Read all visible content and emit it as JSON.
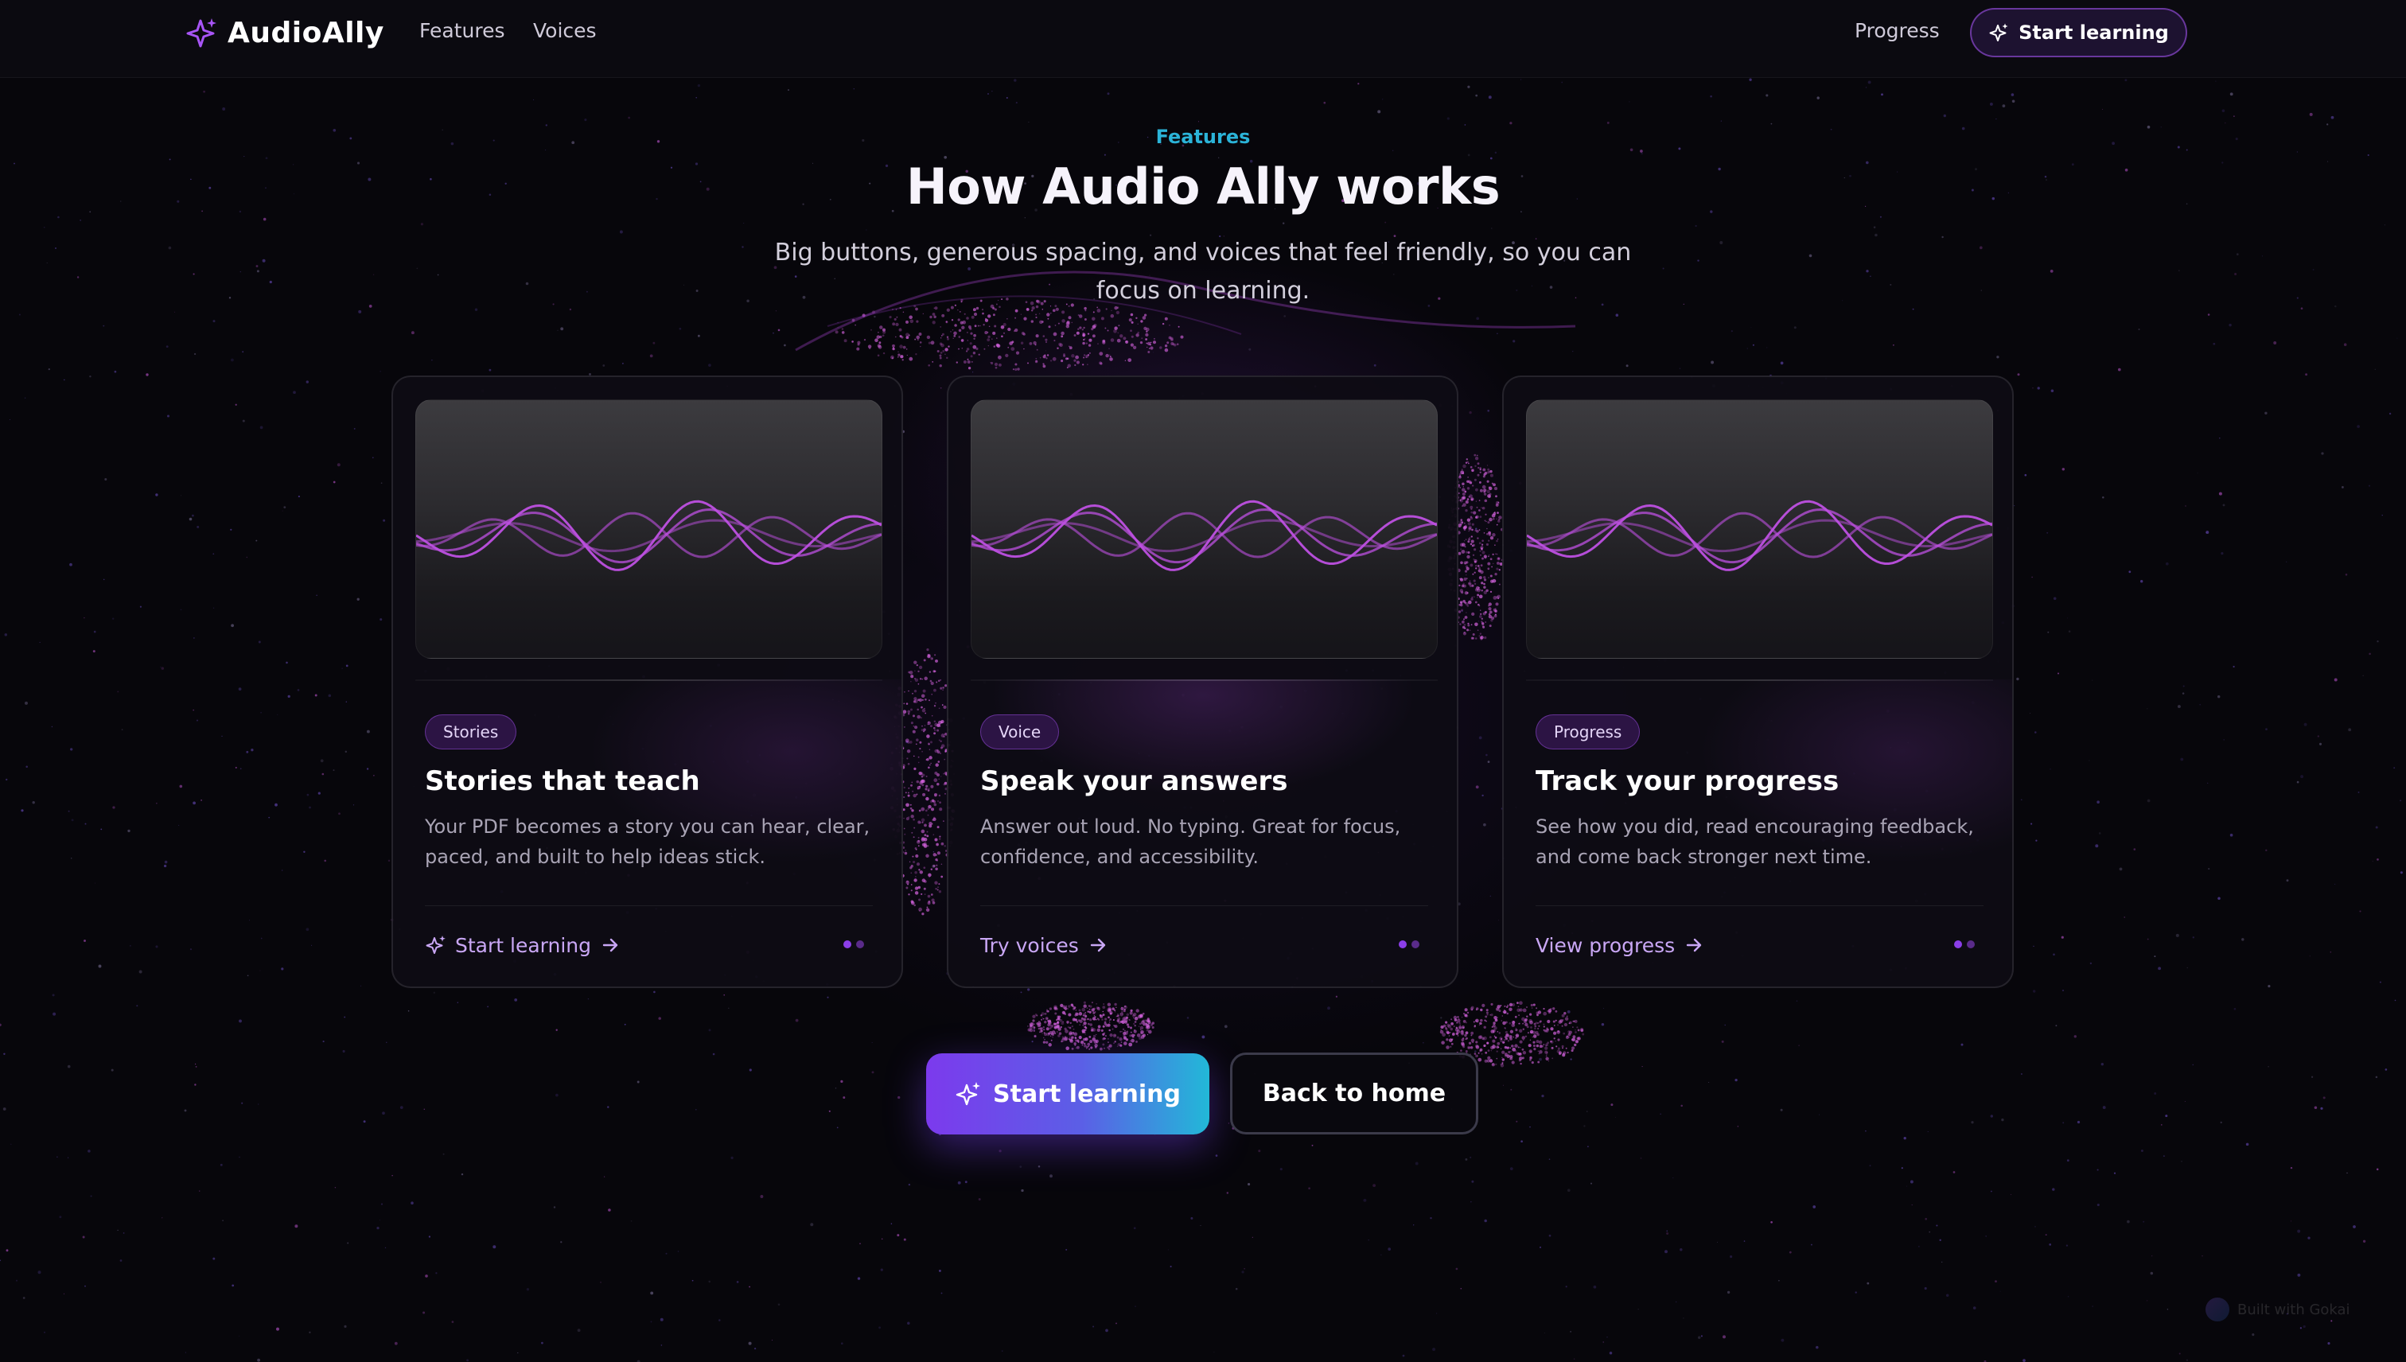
{
  "nav": {
    "brand": "AudioAlly",
    "features": "Features",
    "voices": "Voices",
    "progress": "Progress",
    "cta": "Start learning"
  },
  "header": {
    "eyebrow": "Features",
    "title": "How Audio Ally works",
    "subtitle": "Big buttons, generous spacing, and voices that feel friendly, so you can focus on learning."
  },
  "cards": [
    {
      "badge": "Stories",
      "title": "Stories that teach",
      "description": "Your PDF becomes a story you can hear, clear, paced, and built to help ideas stick.",
      "link": "Start learning",
      "link_icon": "sparkles-icon"
    },
    {
      "badge": "Voice",
      "title": "Speak your answers",
      "description": "Answer out loud. No typing. Great for focus, confidence, and accessibility.",
      "link": "Try voices",
      "link_icon": "none"
    },
    {
      "badge": "Progress",
      "title": "Track your progress",
      "description": "See how you did, read encouraging feedback, and come back stronger next time.",
      "link": "View progress",
      "link_icon": "none"
    }
  ],
  "actions": {
    "primary": "Start learning",
    "secondary": "Back to home"
  },
  "footer": {
    "built_with": "Built with Gokai"
  },
  "colors": {
    "background": "#07060b",
    "accent_purple": "#a855f7",
    "accent_cyan": "#2bb3d8",
    "wave": "#b04ad6"
  }
}
